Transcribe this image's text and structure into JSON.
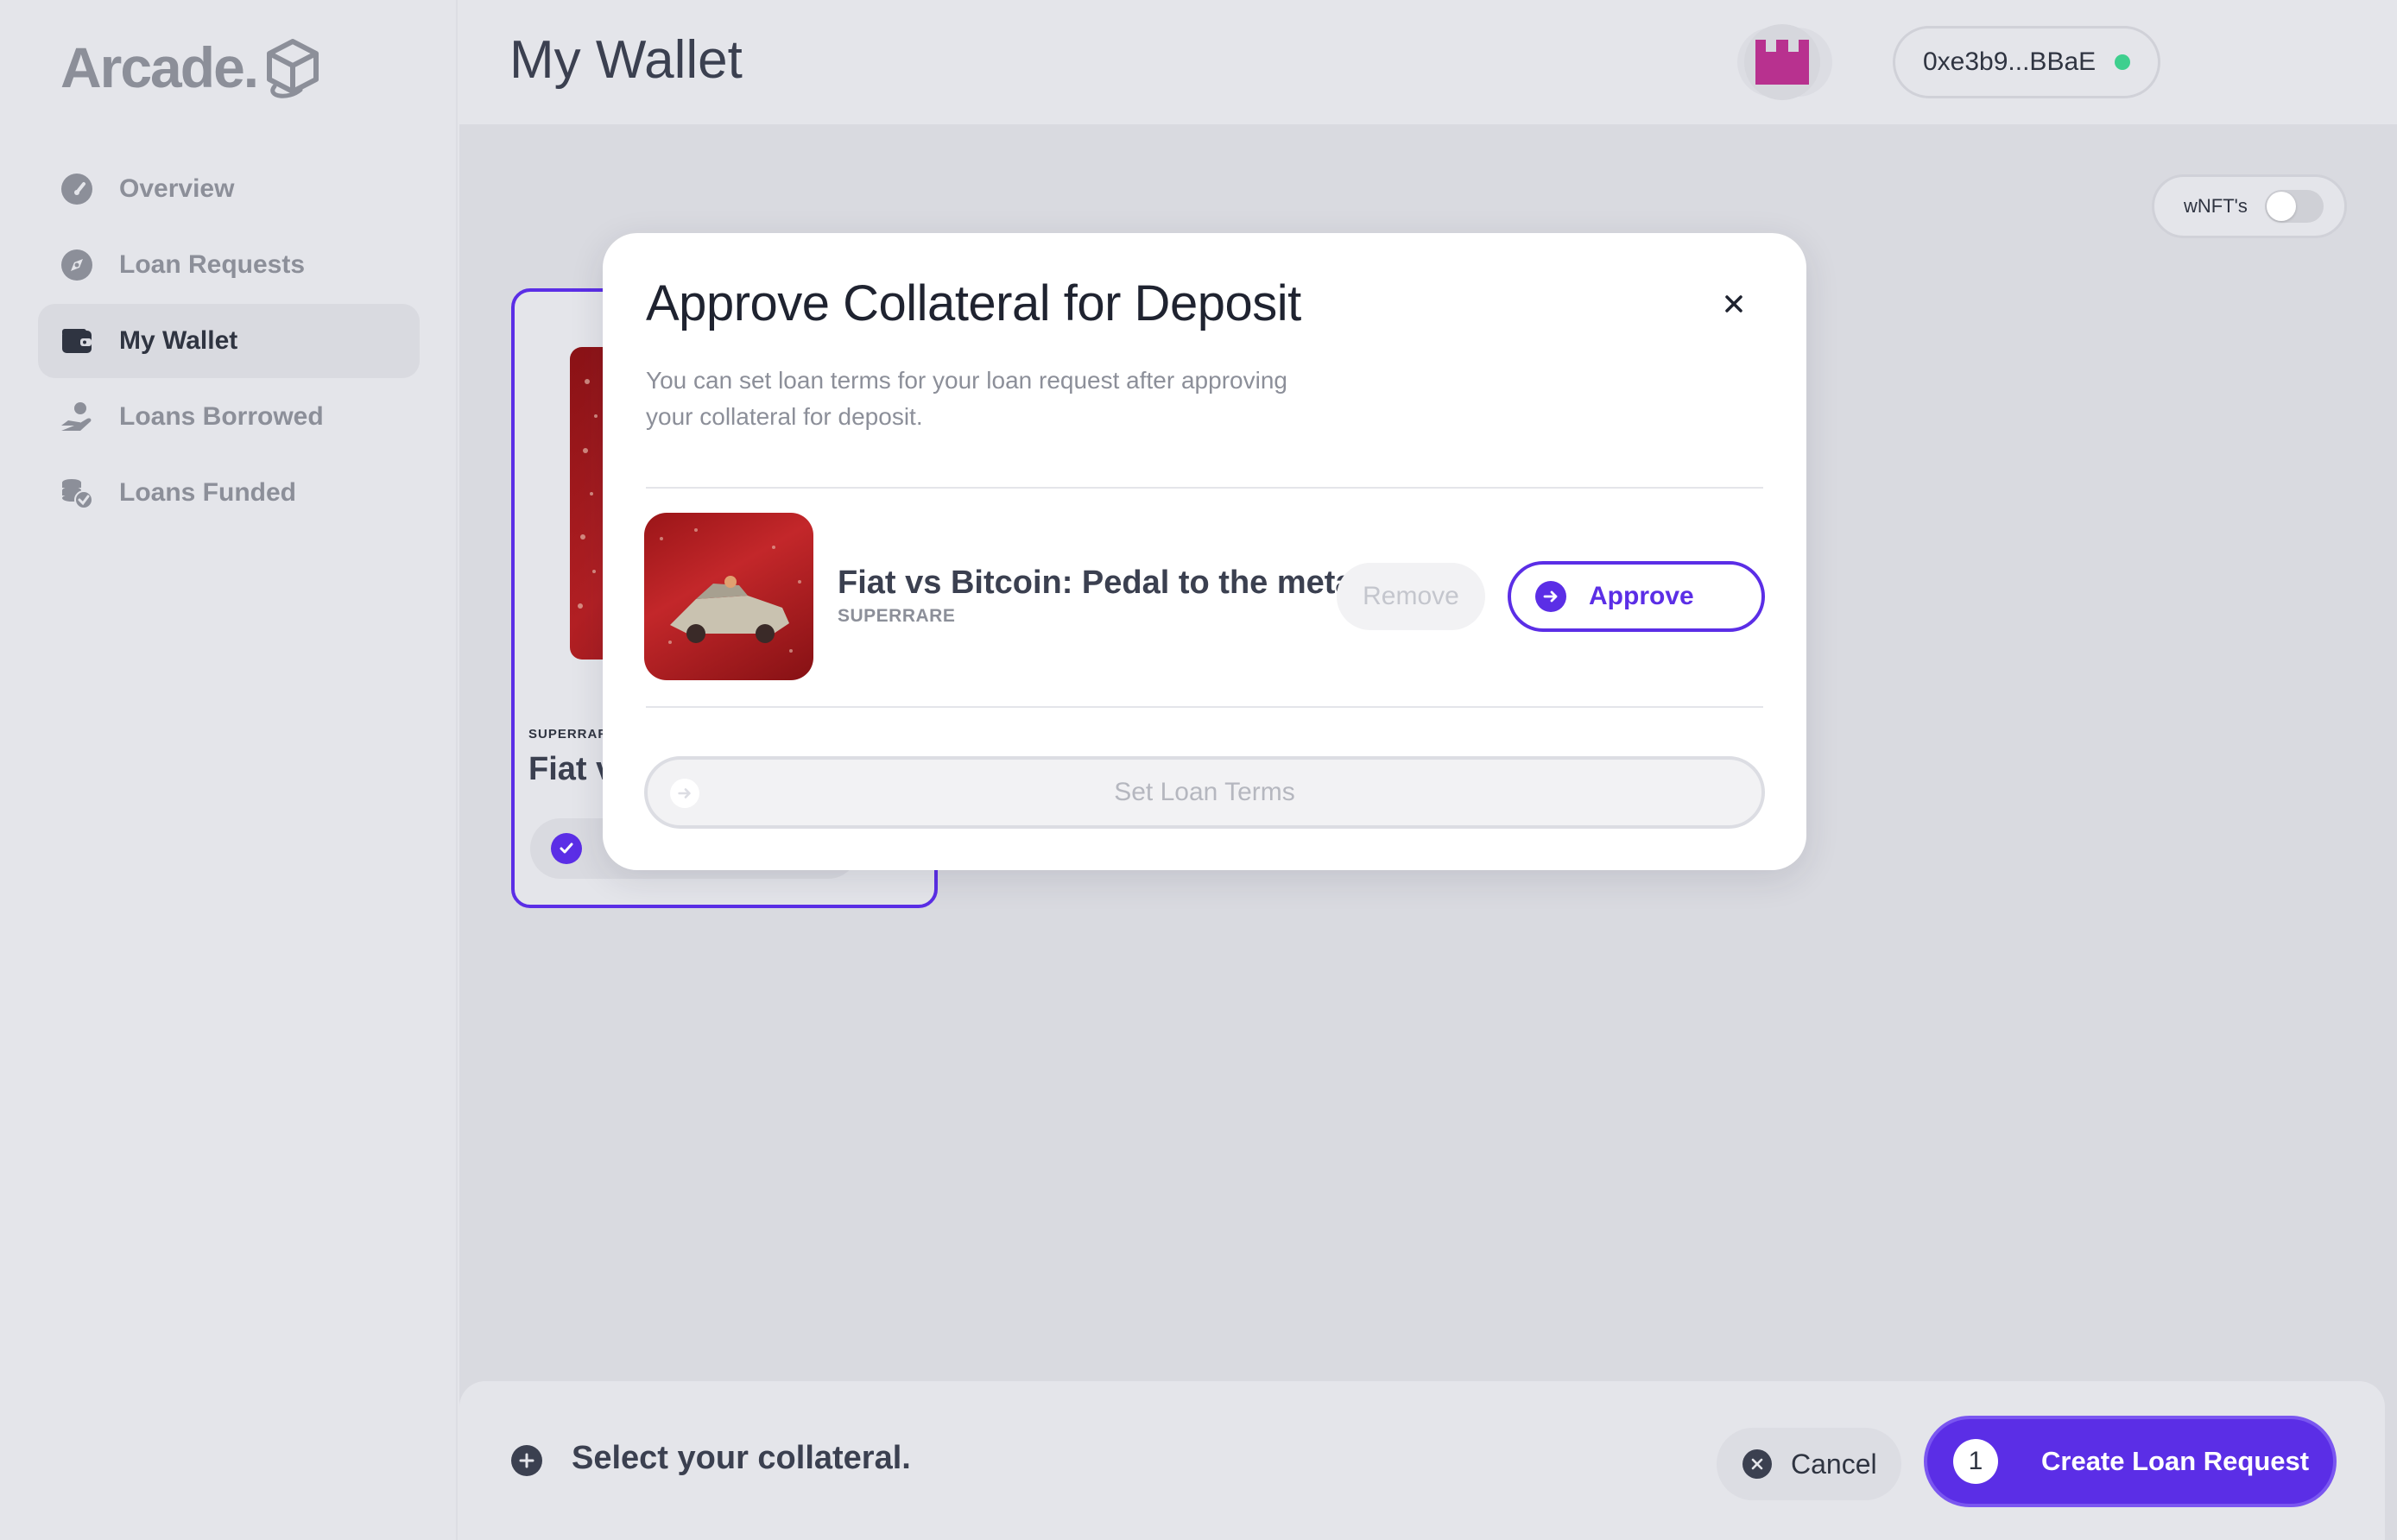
{
  "app": {
    "logo_text": "Arcade."
  },
  "sidebar": {
    "items": [
      {
        "label": "Overview",
        "icon": "gauge-icon",
        "active": false
      },
      {
        "label": "Loan Requests",
        "icon": "compass-icon",
        "active": false
      },
      {
        "label": "My Wallet",
        "icon": "wallet-icon",
        "active": true
      },
      {
        "label": "Loans Borrowed",
        "icon": "hand-coin-icon",
        "active": false
      },
      {
        "label": "Loans Funded",
        "icon": "coins-check-icon",
        "active": false
      }
    ]
  },
  "header": {
    "title": "My Wallet",
    "wallet_address": "0xe3b9...BBaE",
    "theme_icon": "moon-icon"
  },
  "filters": {
    "wnft_label": "wNFT's",
    "wnft_enabled": false
  },
  "card": {
    "source": "SUPERRAR",
    "title": "Fiat v"
  },
  "modal": {
    "title": "Approve Collateral for Deposit",
    "subtitle": "You can set loan terms for your loan request after approving your collateral for deposit.",
    "item": {
      "title": "Fiat vs Bitcoin: Pedal to the metal.",
      "source": "SUPERRARE"
    },
    "remove_label": "Remove",
    "approve_label": "Approve",
    "set_terms_label": "Set Loan Terms"
  },
  "bottom_bar": {
    "prompt": "Select your collateral.",
    "cancel_label": "Cancel",
    "create_count": "1",
    "create_label": "Create Loan Request"
  },
  "colors": {
    "accent": "#5b2ee6",
    "online": "#3ecf8e",
    "avatar": "#b8318f"
  }
}
